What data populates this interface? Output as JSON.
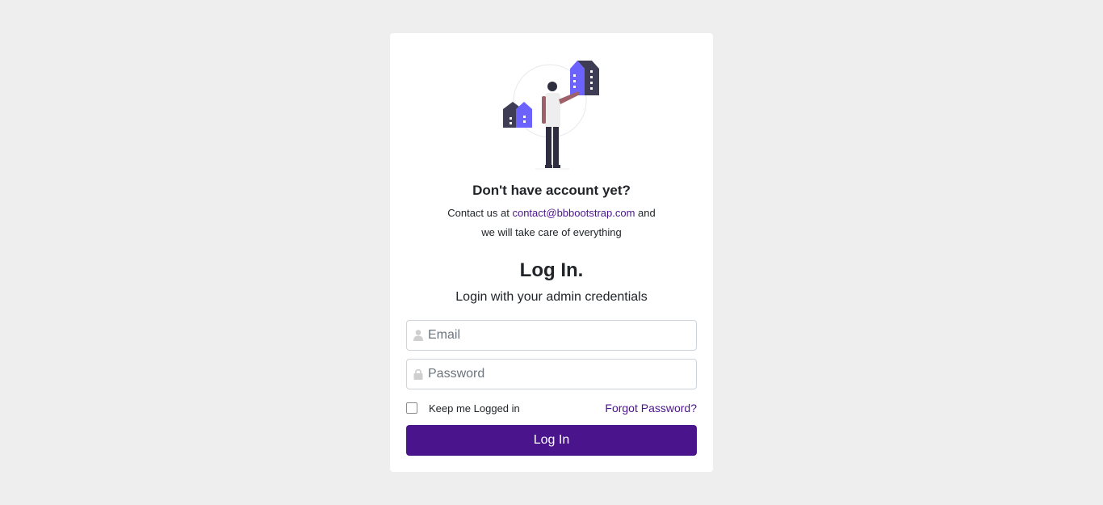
{
  "signup": {
    "title": "Don't have account yet?",
    "text_before": "Contact us at",
    "email": "contact@bbbootstrap.com",
    "text_after": "and",
    "line2": "we will take care of everything"
  },
  "login": {
    "title": "Log In.",
    "subtitle": "Login with your admin credentials",
    "email_placeholder": "Email",
    "password_placeholder": "Password",
    "remember_label": "Keep me Logged in",
    "forgot_label": "Forgot Password?",
    "button_label": "Log In"
  },
  "colors": {
    "background": "#eeeeee",
    "card": "#ffffff",
    "accent": "#4a148c",
    "illustration_purple": "#6c63ff",
    "illustration_dark": "#3f3d56"
  },
  "icons": {
    "email_field": "user-icon",
    "password_field": "lock-icon"
  }
}
